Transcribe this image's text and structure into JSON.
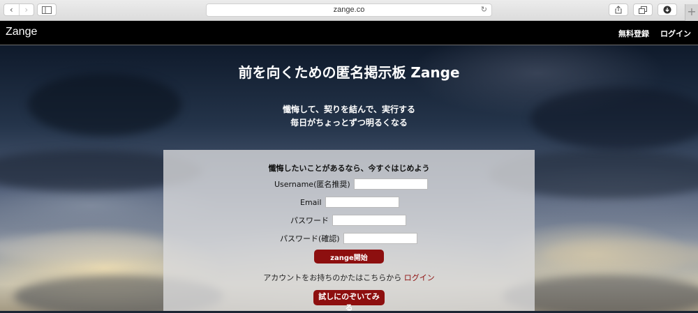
{
  "browser": {
    "url": "zange.co",
    "back_icon": "chevron-left-icon",
    "forward_icon": "chevron-right-icon",
    "sidebar_icon": "sidebar-icon",
    "reload_icon": "reload-icon",
    "share_icon": "share-icon",
    "tabs_icon": "tabs-icon",
    "download_icon": "download-icon",
    "new_tab_icon": "plus-icon"
  },
  "header": {
    "brand": "Zange",
    "links": [
      "無料登録",
      "ログイン"
    ]
  },
  "hero": {
    "headline": "前を向くための匿名掲示板 Zange",
    "tagline_1": "懺悔して、契りを結んで、実行する",
    "tagline_2": "毎日がちょっとずつ明るくなる"
  },
  "form": {
    "title": "懺悔したいことがあるなら、今すぐはじめよう",
    "username_label": "Username(匿名推奨)",
    "email_label": "Email",
    "password_label": "パスワード",
    "password_confirm_label": "パスワード(確認)",
    "username_value": "",
    "email_value": "",
    "password_value": "",
    "password_confirm_value": "",
    "submit_label": "zange開始",
    "account_prompt": "アカウントをお持ちのかたはこちらから",
    "login_link": "ログイン",
    "try_label": "試しにのぞいてみる"
  },
  "colors": {
    "accent": "#8d0f0f",
    "header_bg": "#000000"
  }
}
